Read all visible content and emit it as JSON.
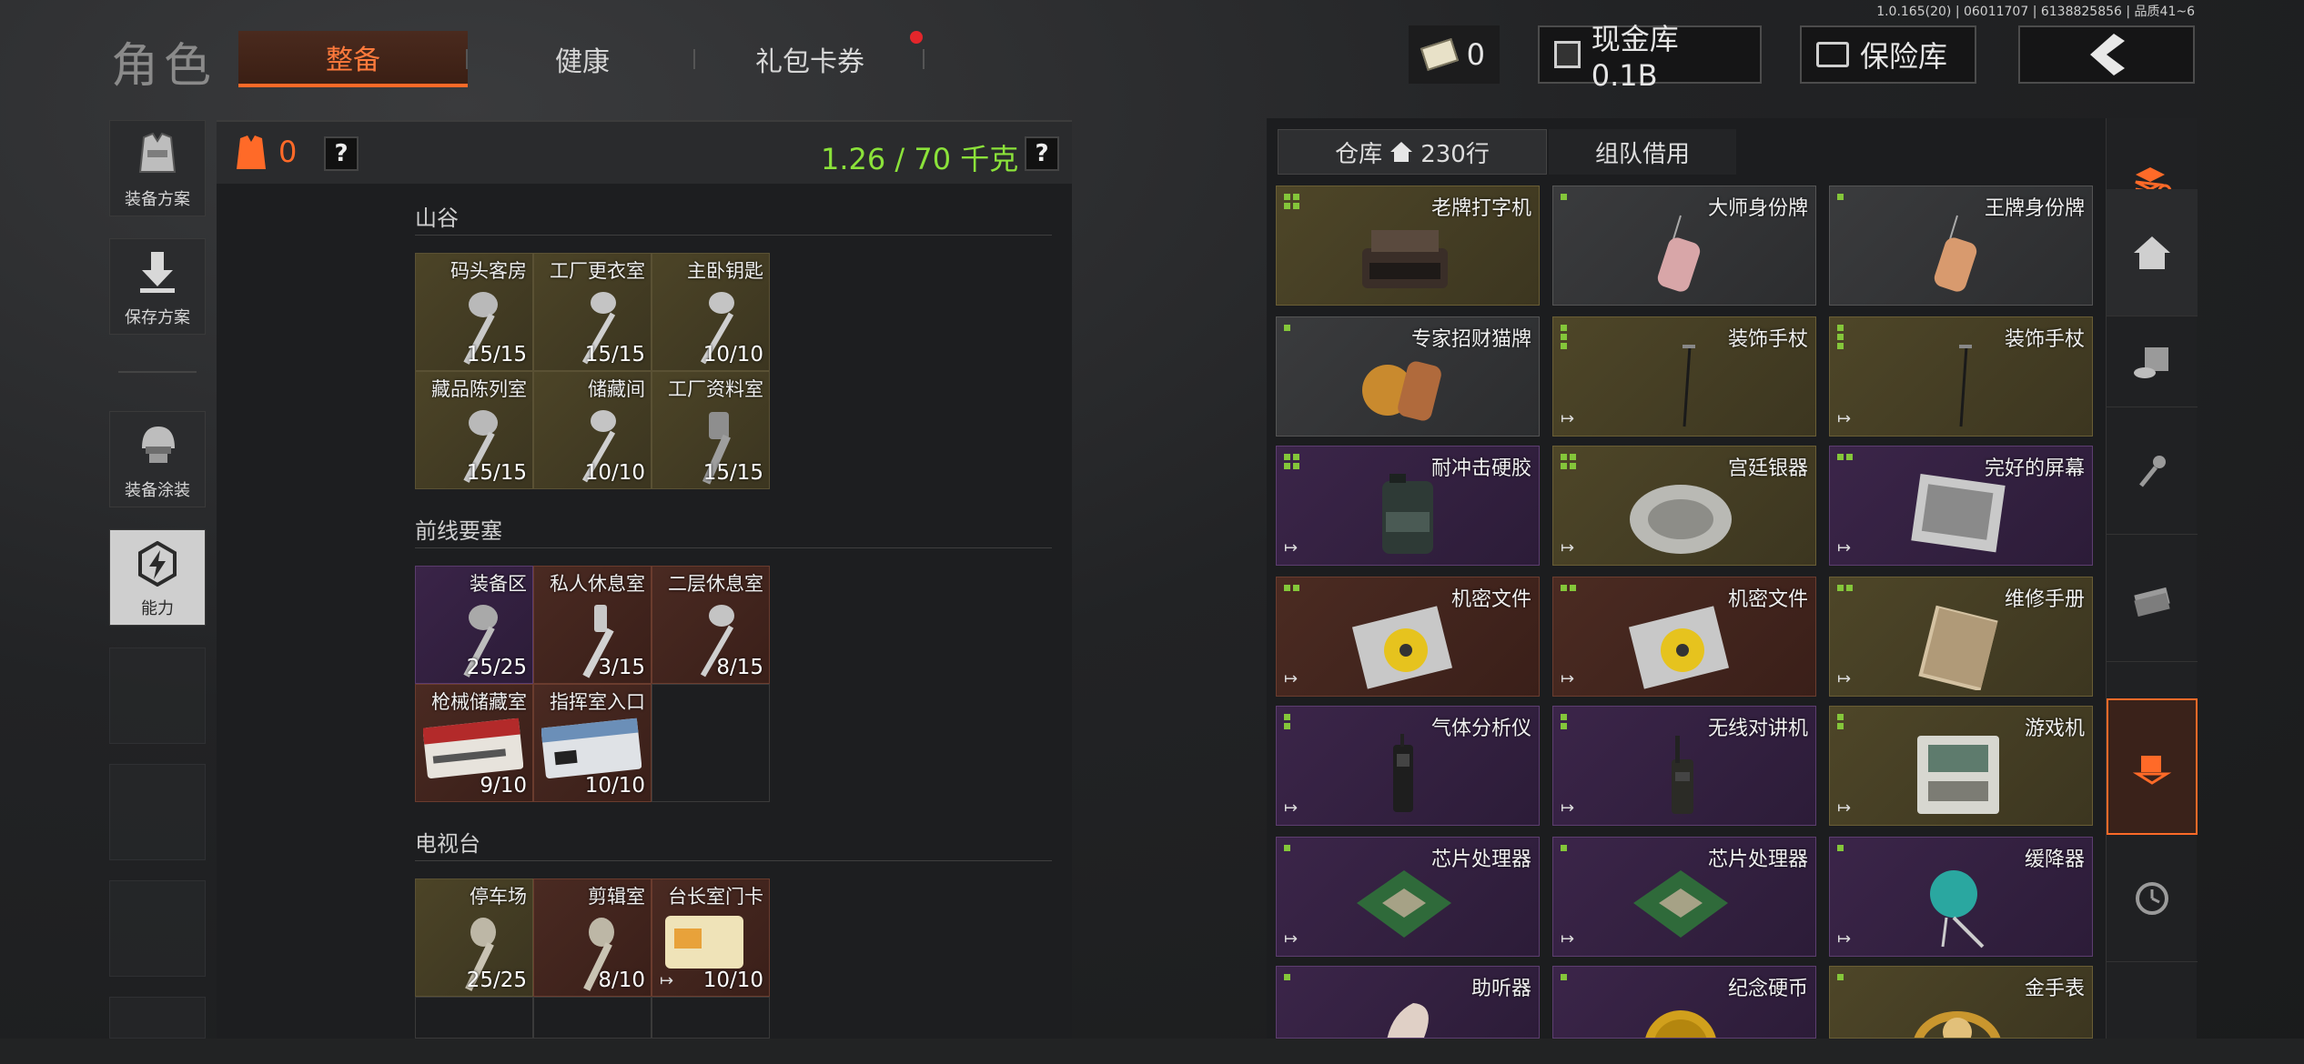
{
  "version": "1.0.165(20) | 06011707 | 6138825856 | 品质41~6",
  "header": {
    "title": "角色",
    "tabs": [
      {
        "label": "整备",
        "active": true
      },
      {
        "label": "健康",
        "active": false
      },
      {
        "label": "礼包卡券",
        "active": false,
        "badge": true
      }
    ],
    "cash": "0",
    "stash_label": "现金库 0.1B",
    "insurance_label": "保险库",
    "back_icon": "chevron-left-icon",
    "accent": "#ff6a28"
  },
  "left_sidebar": {
    "items": [
      {
        "label": "装备方案",
        "icon": "vest-icon"
      },
      {
        "label": "保存方案",
        "icon": "download-icon"
      },
      {
        "label": "装备涂装",
        "icon": "helmet-icon"
      },
      {
        "label": "能力",
        "icon": "ability-icon",
        "active": true
      }
    ]
  },
  "middle": {
    "armor_count": "0",
    "help": "?",
    "weight": "1.26 / 70 千克",
    "help2": "?",
    "sections": [
      {
        "title": "山谷",
        "keys": [
          {
            "name": "码头客房",
            "count": "15/15",
            "bg": "gold"
          },
          {
            "name": "工厂更衣室",
            "count": "15/15",
            "bg": "gold"
          },
          {
            "name": "主卧钥匙",
            "count": "10/10",
            "bg": "gold"
          },
          {
            "name": "藏品陈列室",
            "count": "15/15",
            "bg": "gold"
          },
          {
            "name": "储藏间",
            "count": "10/10",
            "bg": "gold"
          },
          {
            "name": "工厂资料室",
            "count": "15/15",
            "bg": "gold"
          }
        ]
      },
      {
        "title": "前线要塞",
        "keys": [
          {
            "name": "装备区",
            "count": "25/25",
            "bg": "purple"
          },
          {
            "name": "私人休息室",
            "count": "3/15",
            "bg": "red"
          },
          {
            "name": "二层休息室",
            "count": "8/15",
            "bg": "red"
          },
          {
            "name": "枪械储藏室",
            "count": "9/10",
            "bg": "red"
          },
          {
            "name": "指挥室入口",
            "count": "10/10",
            "bg": "red"
          }
        ]
      },
      {
        "title": "电视台",
        "keys": [
          {
            "name": "停车场",
            "count": "25/25",
            "bg": "gold"
          },
          {
            "name": "剪辑室",
            "count": "8/10",
            "bg": "red"
          },
          {
            "name": "台长室门卡",
            "count": "10/10",
            "bg": "red"
          }
        ]
      }
    ]
  },
  "right": {
    "tabs": [
      {
        "label": "仓库",
        "sub": "230行",
        "active": true
      },
      {
        "label": "组队借用",
        "active": false
      }
    ],
    "items": [
      {
        "name": "老牌打字机",
        "bg": "gold",
        "dots": 4,
        "exit": false
      },
      {
        "name": "大师身份牌",
        "bg": "grey",
        "dots": 1,
        "exit": false
      },
      {
        "name": "王牌身份牌",
        "bg": "grey",
        "dots": 1,
        "exit": false
      },
      {
        "name": "专家招财猫牌",
        "bg": "grey",
        "dots": 1,
        "exit": false
      },
      {
        "name": "装饰手杖",
        "bg": "gold",
        "dots": 3,
        "exit": true
      },
      {
        "name": "装饰手杖",
        "bg": "gold",
        "dots": 3,
        "exit": true
      },
      {
        "name": "耐冲击硬胶",
        "bg": "purple",
        "dots": 4,
        "exit": true
      },
      {
        "name": "宫廷银器",
        "bg": "gold",
        "dots": 4,
        "exit": true
      },
      {
        "name": "完好的屏幕",
        "bg": "purple",
        "dots": 2,
        "exit": true
      },
      {
        "name": "机密文件",
        "bg": "red",
        "dots": 2,
        "exit": true
      },
      {
        "name": "机密文件",
        "bg": "red",
        "dots": 2,
        "exit": true
      },
      {
        "name": "维修手册",
        "bg": "gold",
        "dots": 2,
        "exit": true
      },
      {
        "name": "气体分析仪",
        "bg": "purple",
        "dots": 2,
        "exit": true
      },
      {
        "name": "无线对讲机",
        "bg": "purple",
        "dots": 2,
        "exit": true
      },
      {
        "name": "游戏机",
        "bg": "gold",
        "dots": 2,
        "exit": true
      },
      {
        "name": "芯片处理器",
        "bg": "purple",
        "dots": 1,
        "exit": true
      },
      {
        "name": "芯片处理器",
        "bg": "purple",
        "dots": 1,
        "exit": true
      },
      {
        "name": "缓降器",
        "bg": "purple",
        "dots": 1,
        "exit": true
      },
      {
        "name": "助听器",
        "bg": "purple",
        "dots": 1,
        "exit": false
      },
      {
        "name": "纪念硬币",
        "bg": "purple",
        "dots": 1,
        "exit": false
      },
      {
        "name": "金手表",
        "bg": "gold",
        "dots": 1,
        "exit": false
      }
    ]
  },
  "right_sidebar": {
    "items": [
      {
        "icon": "stack-refresh-icon"
      },
      {
        "icon": "home-icon"
      },
      {
        "icon": "coin-safe-icon"
      },
      {
        "icon": "key-icon"
      },
      {
        "icon": "cash-icon"
      },
      {
        "icon": "box-down-icon",
        "active": true
      },
      {
        "icon": "clock-icon"
      }
    ]
  }
}
